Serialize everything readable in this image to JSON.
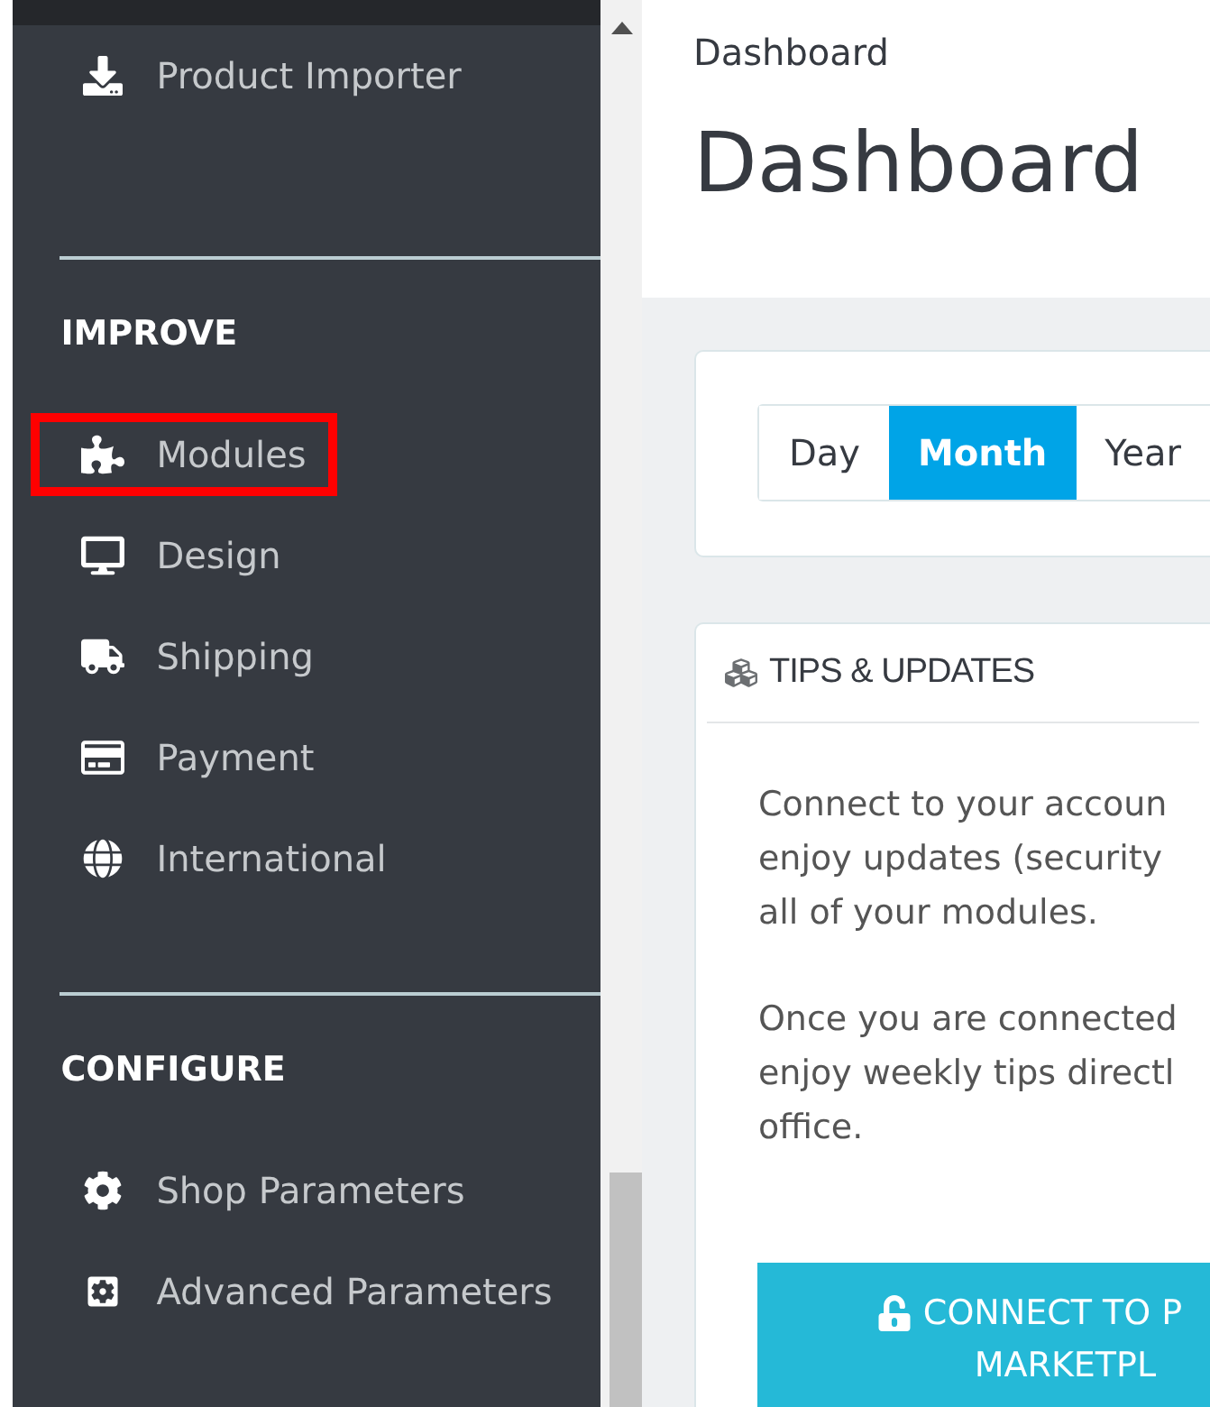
{
  "sidebar": {
    "sections": [
      {
        "items": [
          {
            "label": "Product Importer",
            "kind": "download",
            "highlighted": false
          }
        ]
      },
      {
        "heading": "IMPROVE",
        "items": [
          {
            "label": "Modules",
            "kind": "puzzle",
            "highlighted": true
          },
          {
            "label": "Design",
            "kind": "desktop",
            "highlighted": false
          },
          {
            "label": "Shipping",
            "kind": "truck",
            "highlighted": false
          },
          {
            "label": "Payment",
            "kind": "card",
            "highlighted": false
          },
          {
            "label": "International",
            "kind": "globe",
            "highlighted": false
          }
        ]
      },
      {
        "heading": "CONFIGURE",
        "items": [
          {
            "label": "Shop Parameters",
            "kind": "gear",
            "highlighted": false
          },
          {
            "label": "Advanced Parameters",
            "kind": "gearbox",
            "highlighted": false
          }
        ]
      }
    ]
  },
  "header": {
    "breadcrumb": "Dashboard",
    "title": "Dashboard"
  },
  "period_tabs": [
    {
      "label": "Day",
      "selected": false
    },
    {
      "label": "Month",
      "selected": true
    },
    {
      "label": "Year",
      "selected": false
    }
  ],
  "tips_card": {
    "title": "TIPS & UPDATES",
    "paragraphs": [
      [
        "Connect to your accoun",
        "enjoy updates (security",
        "all of your modules."
      ],
      [
        "Once you are connected",
        "enjoy weekly tips directl",
        "office."
      ]
    ],
    "button_lines": [
      "CONNECT TO P",
      "MARKETPL"
    ]
  }
}
